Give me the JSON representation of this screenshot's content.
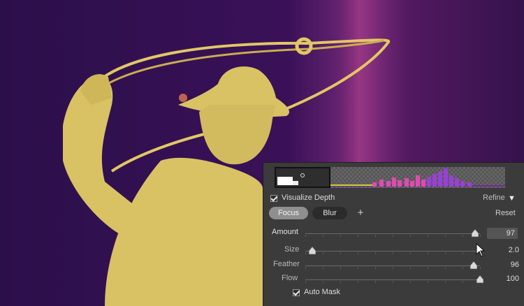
{
  "depth_panel": {
    "visualize_depth_label": "Visualize Depth",
    "visualize_depth_checked": true,
    "refine_label": "Refine",
    "tabs": [
      {
        "label": "Focus",
        "active": true
      },
      {
        "label": "Blur",
        "active": false
      }
    ],
    "add_label": "+",
    "reset_label": "Reset",
    "sliders": [
      {
        "name": "amount",
        "label": "Amount",
        "value": "97",
        "fraction": 0.97
      },
      {
        "name": "size",
        "label": "Size",
        "value": "2.0",
        "fraction": 0.02
      },
      {
        "name": "feather",
        "label": "Feather",
        "value": "96",
        "fraction": 0.96
      },
      {
        "name": "flow",
        "label": "Flow",
        "value": "100",
        "fraction": 1.0
      }
    ],
    "auto_mask_label": "Auto Mask",
    "auto_mask_checked": true
  },
  "colors": {
    "mask_yellow": "#d8c264",
    "background_purple": "#2a0f45",
    "panel_bg": "#3b3b3b",
    "histogram_pink": "#e04bb0",
    "histogram_purple": "#8e3bd0"
  }
}
